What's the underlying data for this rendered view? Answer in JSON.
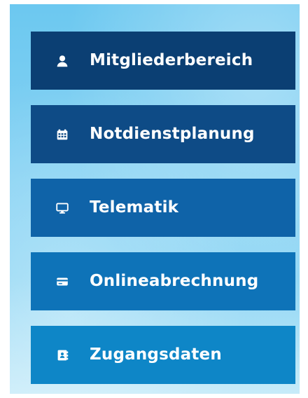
{
  "menu": {
    "items": [
      {
        "label": "Mitgliederbereich",
        "icon": "user-icon",
        "bg": "#0b3f73"
      },
      {
        "label": "Notdienstplanung",
        "icon": "calendar-icon",
        "bg": "#0e4b86"
      },
      {
        "label": "Telematik",
        "icon": "monitor-icon",
        "bg": "#0f63a8"
      },
      {
        "label": "Onlineabrechnung",
        "icon": "credit-card-icon",
        "bg": "#0e73b8"
      },
      {
        "label": "Zugangsdaten",
        "icon": "address-book-icon",
        "bg": "#0e86c7"
      }
    ]
  }
}
